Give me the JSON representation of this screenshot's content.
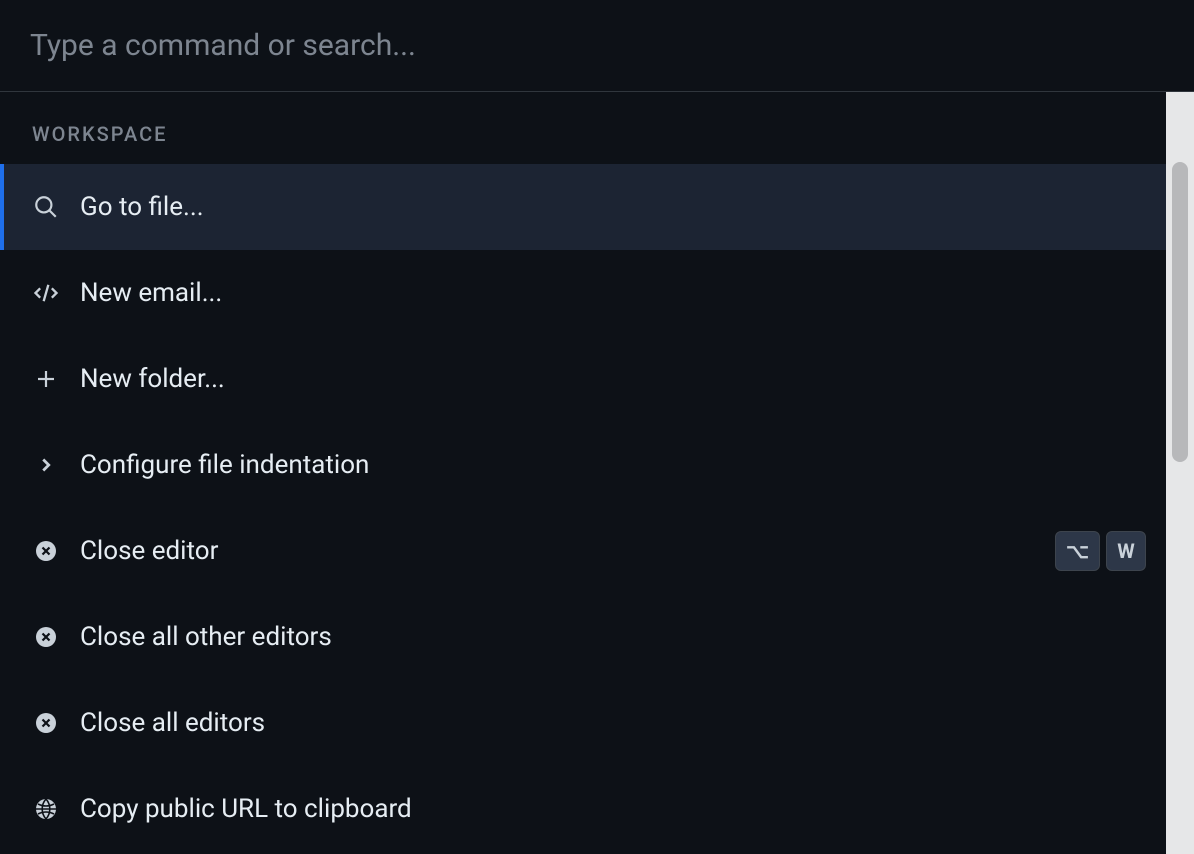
{
  "search": {
    "placeholder": "Type a command or search..."
  },
  "section": {
    "title": "WORKSPACE"
  },
  "commands": [
    {
      "icon": "search",
      "label": "Go to file...",
      "selected": true,
      "shortcut": null
    },
    {
      "icon": "code",
      "label": "New email...",
      "selected": false,
      "shortcut": null
    },
    {
      "icon": "plus",
      "label": "New folder...",
      "selected": false,
      "shortcut": null
    },
    {
      "icon": "chevron-right",
      "label": "Configure file indentation",
      "selected": false,
      "shortcut": null
    },
    {
      "icon": "close-circle",
      "label": "Close editor",
      "selected": false,
      "shortcut": [
        "⌥",
        "W"
      ]
    },
    {
      "icon": "close-circle",
      "label": "Close all other editors",
      "selected": false,
      "shortcut": null
    },
    {
      "icon": "close-circle",
      "label": "Close all editors",
      "selected": false,
      "shortcut": null
    },
    {
      "icon": "globe",
      "label": "Copy public URL to clipboard",
      "selected": false,
      "shortcut": null
    }
  ]
}
